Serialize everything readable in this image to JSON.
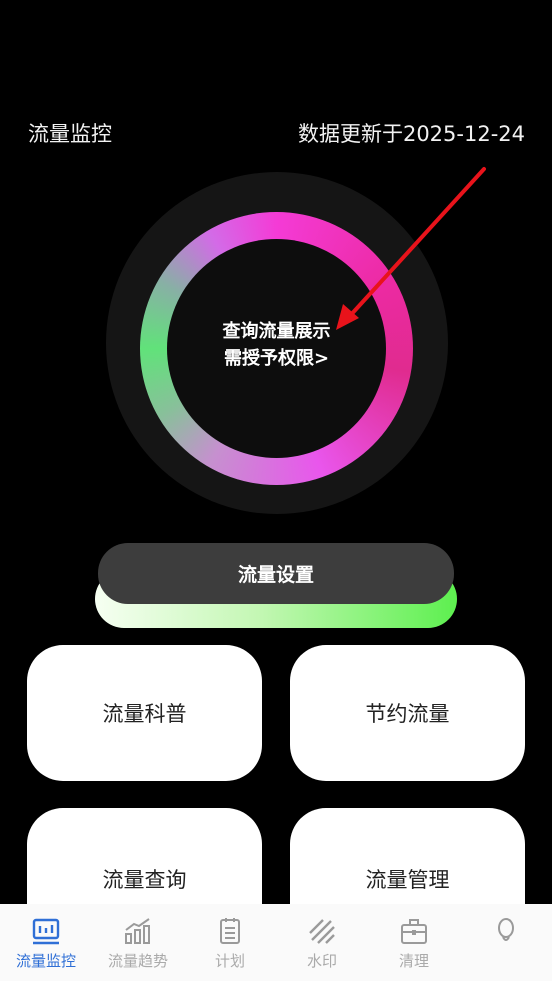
{
  "header": {
    "title": "流量监控",
    "update_text": "数据更新于2025-12-24"
  },
  "gauge": {
    "line1": "查询流量展示",
    "line2": "需授予权限>"
  },
  "settings_button": "流量设置",
  "cards": [
    {
      "label": "流量科普"
    },
    {
      "label": "节约流量"
    },
    {
      "label": "流量查询"
    },
    {
      "label": "流量管理"
    }
  ],
  "bottom_nav": [
    {
      "label": "流量监控",
      "icon": "monitor-icon",
      "active": true
    },
    {
      "label": "流量趋势",
      "icon": "trend-chart-icon",
      "active": false
    },
    {
      "label": "计划",
      "icon": "clipboard-icon",
      "active": false
    },
    {
      "label": "水印",
      "icon": "watermark-icon",
      "active": false
    },
    {
      "label": "清理",
      "icon": "briefcase-icon",
      "active": false
    },
    {
      "label": "",
      "icon": "profile-icon",
      "active": false
    }
  ],
  "colors": {
    "accent": "#2f6fd6",
    "arrow": "#e8131b",
    "ring_green": "#61e27a",
    "ring_pink": "#f43bd6"
  }
}
